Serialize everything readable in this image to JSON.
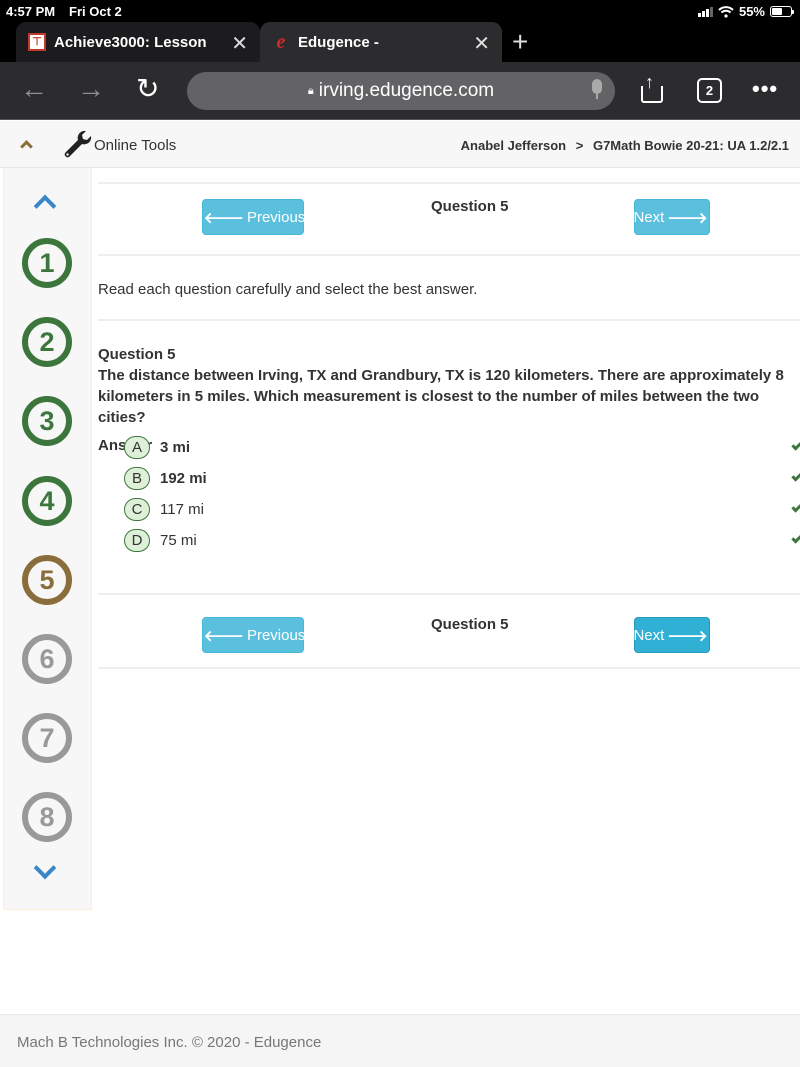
{
  "status_bar": {
    "time": "4:57 PM",
    "date": "Fri Oct 2",
    "battery": "55%",
    "battery_level": 0.55
  },
  "browser": {
    "tabs": [
      {
        "title": "Achieve3000: Lesson",
        "favicon": "achieve3000-icon",
        "active": false
      },
      {
        "title": "Edugence -",
        "favicon": "edugence-icon",
        "active": true
      }
    ],
    "url": "irving.edugence.com",
    "tab_count": "2"
  },
  "header": {
    "tools_label": "Online Tools",
    "breadcrumb": {
      "user": "Anabel Jefferson",
      "separator": ">",
      "assessment": "G7Math Bowie 20-21: UA 1.2/2.1"
    }
  },
  "sidebar": {
    "questions": [
      {
        "number": "1",
        "state": "done"
      },
      {
        "number": "2",
        "state": "done"
      },
      {
        "number": "3",
        "state": "done"
      },
      {
        "number": "4",
        "state": "done"
      },
      {
        "number": "5",
        "state": "current"
      },
      {
        "number": "6",
        "state": "todo"
      },
      {
        "number": "7",
        "state": "todo"
      },
      {
        "number": "8",
        "state": "todo"
      }
    ]
  },
  "nav": {
    "previous_label": "Previous",
    "next_label": "Next",
    "question_label": "Question 5"
  },
  "instructions": "Read each question carefully and select the best answer.",
  "question": {
    "title": "Question 5",
    "text": "The distance between Irving, TX and Grandbury, TX is 120 kilometers. There are approximately 8 kilometers in 5 miles. Which measurement is closest to the number of miles between the two cities?",
    "answer_label": "Answer",
    "options": [
      {
        "letter": "A",
        "text": "3 mi",
        "bold": true
      },
      {
        "letter": "B",
        "text": "192 mi",
        "bold": true
      },
      {
        "letter": "C",
        "text": "117 mi",
        "bold": false
      },
      {
        "letter": "D",
        "text": "75 mi",
        "bold": false
      }
    ]
  },
  "footer": {
    "copyright": "Mach B Technologies Inc. © 2020 - Edugence"
  },
  "colors": {
    "done": "#3c763d",
    "current": "#8a6d3b",
    "todo": "#999999",
    "button": "#5bc0de",
    "arrow": "#3a87c8"
  }
}
